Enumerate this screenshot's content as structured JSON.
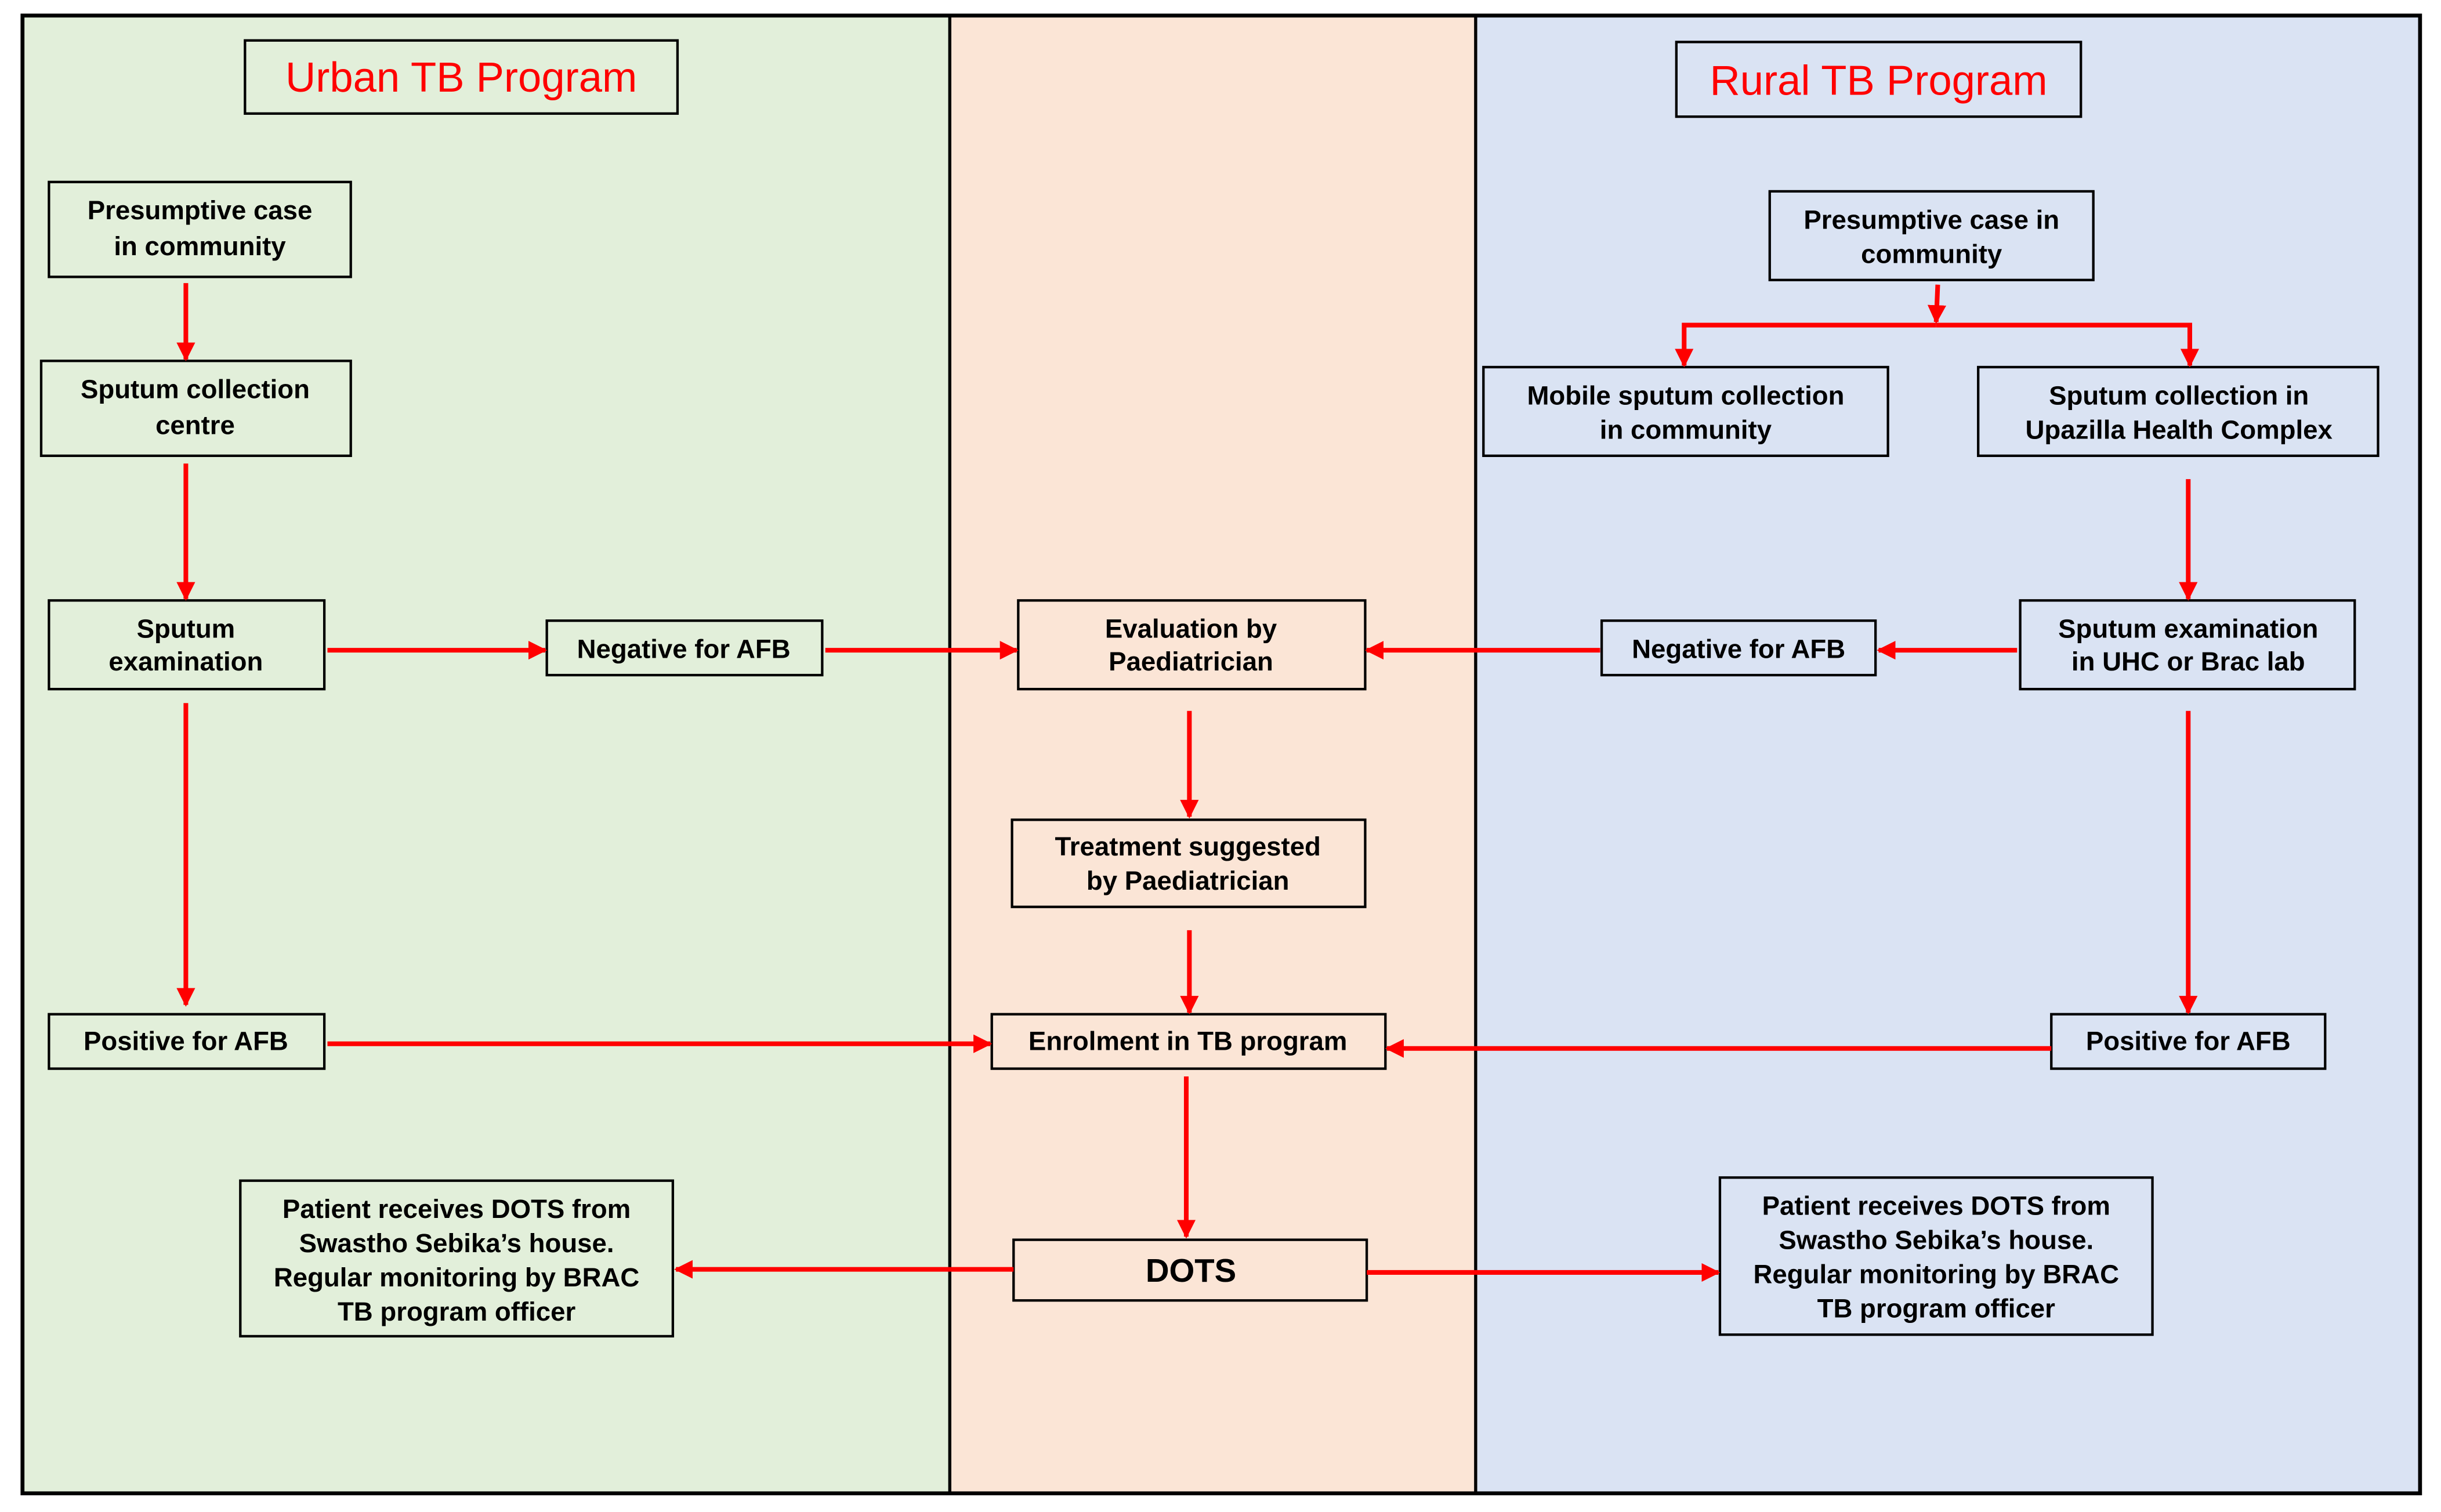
{
  "colors": {
    "urban_bg": "#e2efda",
    "center_bg": "#fbe5d6",
    "rural_bg": "#dae3f3",
    "arrow": "#ff0000",
    "title_text": "#ff0000"
  },
  "urban": {
    "title": "Urban TB Program",
    "presumptive": [
      "Presumptive case",
      "in community"
    ],
    "collection": [
      "Sputum collection",
      "centre"
    ],
    "exam": [
      "Sputum",
      "examination"
    ],
    "negative": "Negative for AFB",
    "positive": "Positive for AFB",
    "dots_patient": [
      "Patient receives DOTS from",
      "Swastho Sebika’s house.",
      "Regular monitoring by BRAC",
      "TB program officer"
    ]
  },
  "center": {
    "evaluation": [
      "Evaluation by",
      "Paediatrician"
    ],
    "treatment": [
      "Treatment suggested",
      "by Paediatrician"
    ],
    "enrolment": "Enrolment in TB program",
    "dots": "DOTS"
  },
  "rural": {
    "title": "Rural TB Program",
    "presumptive": [
      "Presumptive case in",
      "community"
    ],
    "mobile": [
      "Mobile sputum collection",
      "in community"
    ],
    "uhc_collection": [
      "Sputum collection in",
      "Upazilla Health Complex"
    ],
    "exam": [
      "Sputum examination",
      "in UHC or Brac lab"
    ],
    "negative": "Negative for AFB",
    "positive": "Positive for AFB",
    "dots_patient": [
      "Patient receives DOTS from",
      "Swastho Sebika’s house.",
      "Regular monitoring by BRAC",
      "TB program officer"
    ]
  }
}
